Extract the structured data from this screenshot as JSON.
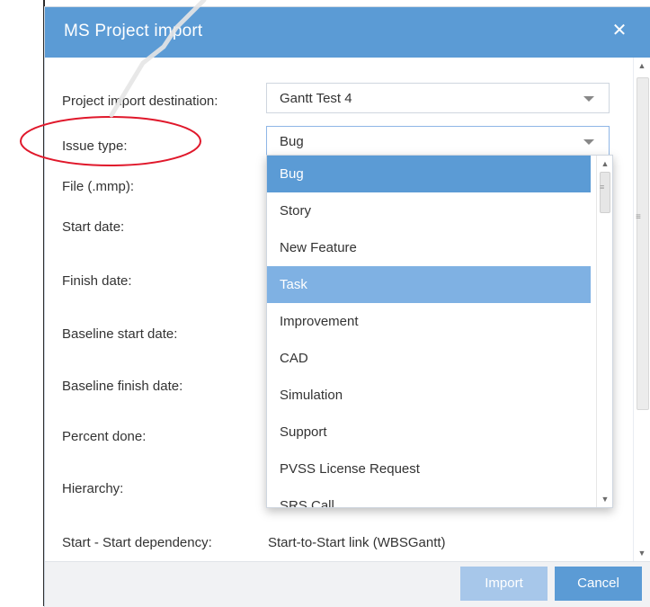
{
  "dialog": {
    "title": "MS Project import",
    "close_icon": "close-icon"
  },
  "form": {
    "destination": {
      "label": "Project import destination:",
      "value": "Gantt Test 4"
    },
    "issue_type": {
      "label": "Issue type:",
      "value": "Bug"
    },
    "file": {
      "label": "File (.mmp):"
    },
    "start_date": {
      "label": "Start date:"
    },
    "finish_date": {
      "label": "Finish date:"
    },
    "baseline_start": {
      "label": "Baseline start date:"
    },
    "baseline_finish": {
      "label": "Baseline finish date:"
    },
    "percent_done": {
      "label": "Percent done:"
    },
    "hierarchy": {
      "label": "Hierarchy:"
    },
    "start_start": {
      "label": "Start - Start dependency:",
      "value": "Start-to-Start link (WBSGantt)"
    }
  },
  "dropdown": {
    "options": [
      "Bug",
      "Story",
      "New Feature",
      "Task",
      "Improvement",
      "CAD",
      "Simulation",
      "Support",
      "PVSS License Request",
      "SRS Call"
    ],
    "selected": "Bug",
    "hovered": "Task"
  },
  "footer": {
    "import_label": "Import",
    "cancel_label": "Cancel"
  },
  "colors": {
    "header": "#5b9bd5",
    "selected": "#5b9bd5",
    "hover": "#7fb1e3",
    "annotation": "#e0182b"
  }
}
